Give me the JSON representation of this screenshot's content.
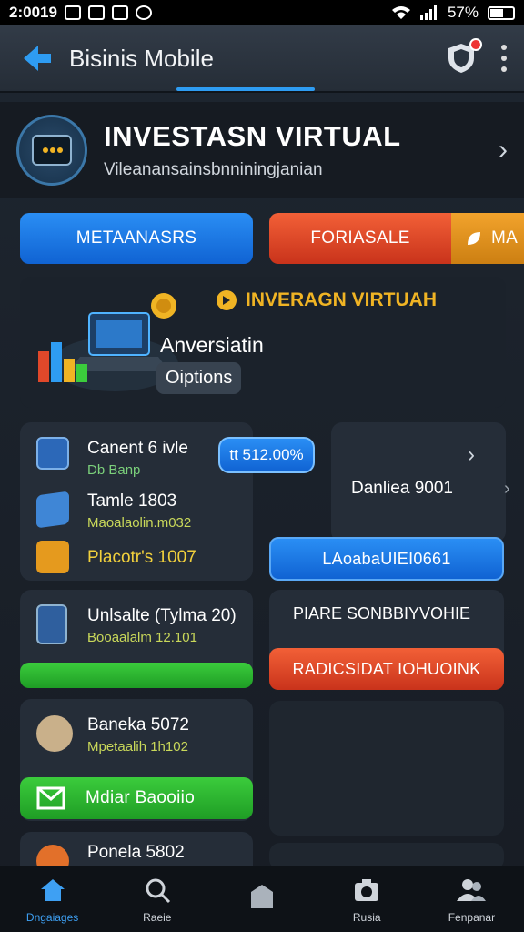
{
  "status": {
    "time": "2:0019",
    "battery": "57%"
  },
  "appbar": {
    "title": "Bisinis Mobile"
  },
  "hero": {
    "title": "INVESTASN VIRTUAL",
    "subtitle": "Vileanansainsbnniningjanian"
  },
  "buttons": {
    "blue": "METAANASRS",
    "red": "FORIASALE",
    "orange": "MA"
  },
  "promo": {
    "title": "INVERAGN VIRTUAH",
    "text": "Anversiatin",
    "chip": "Oiptions"
  },
  "list1": {
    "items": [
      {
        "title": "Canent 6 ivle",
        "sub": "Db Banp"
      },
      {
        "title": "Tamle 1803",
        "sub": "Maoalaolin.m032"
      },
      {
        "title": "Placotr's 1007",
        "sub": ""
      }
    ],
    "pill": "tt 512.00%"
  },
  "right1": {
    "label": "Danliea 9001",
    "button": "LAoabaUIEI0661"
  },
  "list2": {
    "title": "Unlsalte (Tylma 20)",
    "sub": "Booaalalm 12.101"
  },
  "right2": {
    "label": "PIARE SONBBIYVOHIE",
    "button": "RADICSIDAT IOHUOINK"
  },
  "list3": {
    "title": "Baneka 5072",
    "sub": "Mpetaalih 1h102",
    "button": "Mdiar Baooiio"
  },
  "list4": {
    "title": "Ponela 5802"
  },
  "nav": [
    {
      "label": "Dngaiages"
    },
    {
      "label": "Raeie"
    },
    {
      "label": ""
    },
    {
      "label": "Rusia"
    },
    {
      "label": "Fenpanar"
    }
  ],
  "colors": {
    "accent": "#2e9cf2",
    "blue": "#1a78e6",
    "red": "#e0482a",
    "green": "#2fb832",
    "orange": "#e8961e",
    "yellow": "#f0b424"
  }
}
